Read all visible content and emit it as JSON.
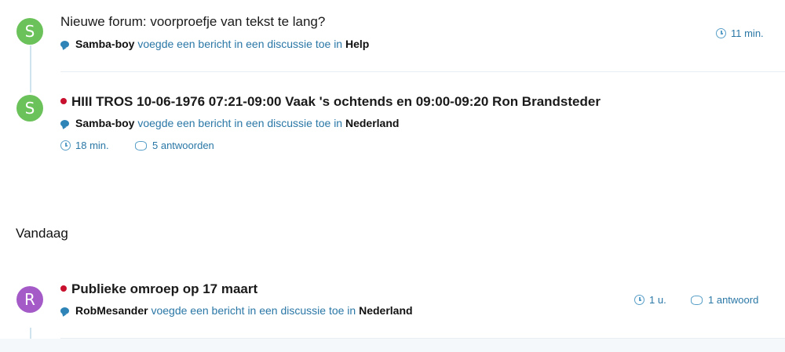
{
  "items": [
    {
      "avatar_letter": "S",
      "avatar_color": "#6cc25a",
      "title": "Nieuwe forum: voorproefje van tekst te lang?",
      "unread": false,
      "user": "Samba-boy",
      "action": "voegde een bericht in een discussie toe in",
      "forum": "Help",
      "time": "11 min."
    },
    {
      "avatar_letter": "S",
      "avatar_color": "#6cc25a",
      "title": "HIII TROS 10-06-1976 07:21-09:00 Vaak 's ochtends en 09:00-09:20 Ron Brandsteder",
      "unread": true,
      "user": "Samba-boy",
      "action": "voegde een bericht in een discussie toe in",
      "forum": "Nederland",
      "time": "18 min.",
      "replies": "5 antwoorden"
    },
    {
      "avatar_letter": "R",
      "avatar_color": "#a45bc8",
      "title": "Publieke omroep op 17 maart",
      "unread": true,
      "user": "RobMesander",
      "action": "voegde een bericht in een discussie toe in",
      "forum": "Nederland",
      "time": "1 u.",
      "replies": "1 antwoord"
    }
  ],
  "section_heading": "Vandaag",
  "colors": {
    "link": "#2a77a6",
    "unread_dot": "#c8102e",
    "timeline": "#cfe3ee"
  },
  "icons": [
    "comment-bubble-icon",
    "clock-icon",
    "replies-icon"
  ]
}
